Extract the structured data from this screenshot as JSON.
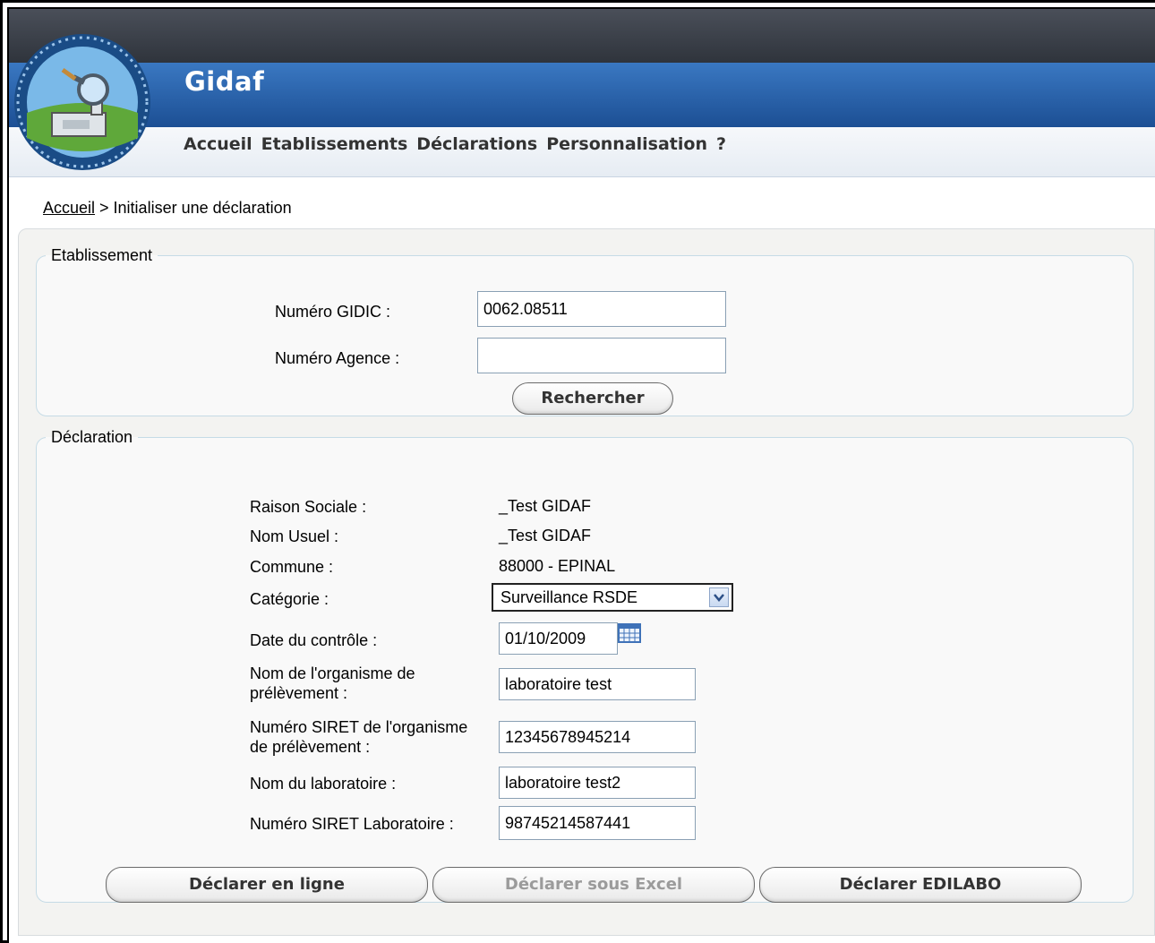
{
  "app": {
    "title": "Gidaf"
  },
  "nav": {
    "items": [
      "Accueil",
      "Etablissements",
      "Déclarations",
      "Personnalisation",
      "?"
    ]
  },
  "breadcrumb": {
    "home": "Accueil",
    "separator": " > ",
    "current": "Initialiser une déclaration"
  },
  "etablissement": {
    "legend": "Etablissement",
    "gidic_label": "Numéro GIDIC :",
    "gidic_value": "0062.08511",
    "agence_label": "Numéro Agence :",
    "agence_value": "",
    "search_button": "Rechercher"
  },
  "declaration": {
    "legend": "Déclaration",
    "raison_label": "Raison Sociale :",
    "raison_value": "_Test GIDAF",
    "nom_usuel_label": "Nom Usuel :",
    "nom_usuel_value": "_Test GIDAF",
    "commune_label": "Commune :",
    "commune_value": "88000 - EPINAL",
    "categorie_label": "Catégorie :",
    "categorie_value": "Surveillance RSDE",
    "date_label": "Date du contrôle :",
    "date_value": "01/10/2009",
    "organisme_label_1": "Nom de l'organisme de",
    "organisme_label_2": "prélèvement :",
    "organisme_value": "laboratoire test",
    "siret_org_label_1": "Numéro SIRET de l'organisme",
    "siret_org_label_2": "de prélèvement :",
    "siret_org_value": "12345678945214",
    "labo_label": "Nom du laboratoire :",
    "labo_value": "laboratoire test2",
    "siret_labo_label": "Numéro SIRET Laboratoire :",
    "siret_labo_value": "98745214587441"
  },
  "actions": {
    "online": "Déclarer en ligne",
    "excel": "Déclarer sous Excel",
    "edilabo": "Déclarer EDILABO"
  },
  "colors": {
    "header_blue": "#1c4f94",
    "topbar": "#2f343c",
    "field_border": "#c5dbe6"
  },
  "icons": [
    "gidaf-logo",
    "chevron-down-icon",
    "calendar-icon"
  ]
}
